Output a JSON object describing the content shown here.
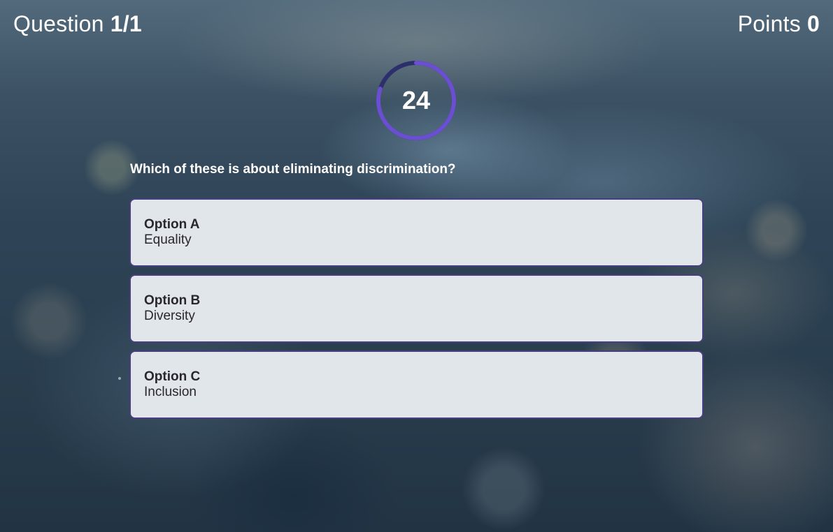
{
  "header": {
    "question_label": "Question",
    "question_counter": "1/1",
    "points_label": "Points",
    "points_value": "0"
  },
  "timer": {
    "seconds_remaining": "24",
    "progress_fraction": 0.8,
    "ring_color": "#6a4fd0",
    "track_color": "#2c2f6b"
  },
  "question": {
    "text": "Which of these is about eliminating discrimination?"
  },
  "options": [
    {
      "label": "Option A",
      "text": "Equality"
    },
    {
      "label": "Option B",
      "text": "Diversity"
    },
    {
      "label": "Option C",
      "text": "Inclusion"
    }
  ],
  "colors": {
    "option_background": "#e1e6ea",
    "option_border": "#4a3f7e"
  }
}
